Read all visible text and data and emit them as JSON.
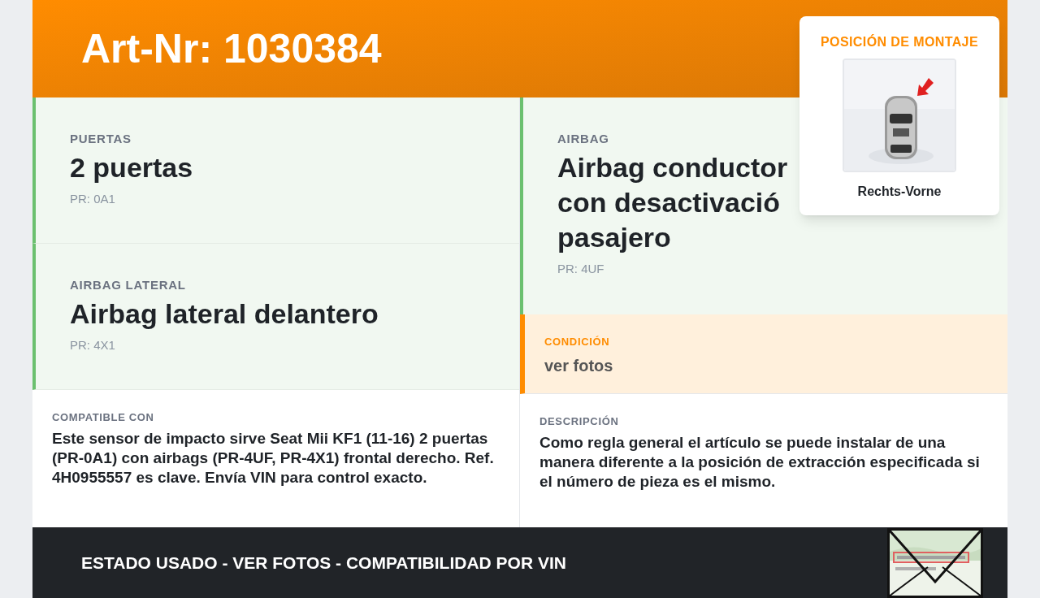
{
  "header": {
    "title": "Art-Nr: 1030384"
  },
  "mounting_position": {
    "title": "POSICIÓN DE MONTAJE",
    "label": "Rechts-Vorne"
  },
  "features": [
    {
      "label": "PUERTAS",
      "value": "2 puertas",
      "code": "PR: 0A1"
    },
    {
      "label": "AIRBAG LATERAL",
      "value": "Airbag lateral delantero",
      "code": "PR: 4X1"
    },
    {
      "label": "AIRBAG",
      "lines": [
        "Airbag conductor",
        "con desactivació",
        "pasajero"
      ],
      "code": "PR: 4UF"
    }
  ],
  "condition": {
    "label": "CONDICIÓN",
    "value": "ver fotos"
  },
  "compatible": {
    "label": "COMPATIBLE CON",
    "text": "Este sensor de impacto sirve Seat Mii KF1 (11-16) 2 puertas (PR-0A1) con airbags (PR-4UF, PR-4X1) frontal derecho. Ref. 4H0955557 es clave. Envía VIN para control exacto."
  },
  "description": {
    "label": "DESCRIPCIÓN",
    "text": "Como regla general el artículo se puede instalar de una manera diferente a la posición de extracción especificada si el número de pieza es el mismo."
  },
  "footer": {
    "text": "ESTADO USADO - VER FOTOS - COMPATIBILIDAD POR VIN"
  }
}
